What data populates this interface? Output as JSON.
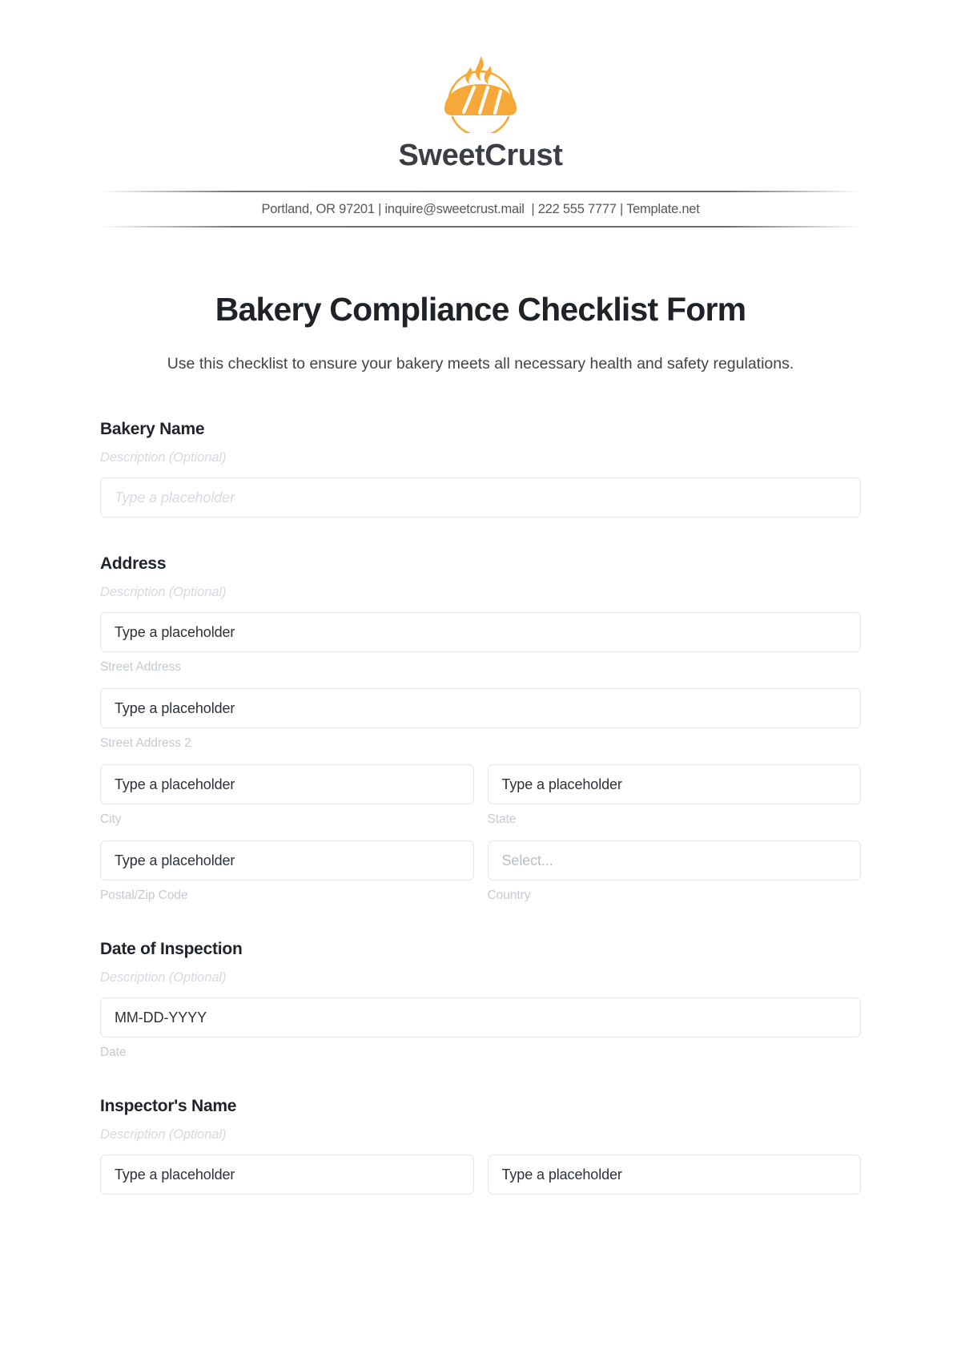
{
  "brand": {
    "name": "SweetCrust",
    "logo_icon": "bread-loaf-flame-icon",
    "contact": "Portland, OR 97201 | inquire@sweetcrust.mail  | 222 555 7777 | Template.net",
    "accent_color": "#F6A939",
    "text_color": "#3B3F45"
  },
  "form": {
    "title": "Bakery Compliance Checklist Form",
    "subtitle": "Use this checklist to ensure your bakery meets all necessary health and safety regulations.",
    "description_placeholder": "Description (Optional)",
    "groups": [
      {
        "label": "Bakery Name",
        "description": "Description (Optional)",
        "rows": [
          {
            "fields": [
              {
                "value": "Type a placeholder",
                "sub_label": "",
                "style": "ghost",
                "name": "bakery-name-input"
              }
            ]
          }
        ]
      },
      {
        "label": "Address",
        "description": "Description (Optional)",
        "rows": [
          {
            "fields": [
              {
                "value": "Type a placeholder",
                "sub_label": "Street Address",
                "style": "filled",
                "name": "street-address-input"
              }
            ]
          },
          {
            "fields": [
              {
                "value": "Type a placeholder",
                "sub_label": "Street Address 2",
                "style": "filled",
                "name": "street-address-2-input"
              }
            ]
          },
          {
            "fields": [
              {
                "value": "Type a placeholder",
                "sub_label": "City",
                "style": "filled",
                "name": "city-input"
              },
              {
                "value": "Type a placeholder",
                "sub_label": "State",
                "style": "filled",
                "name": "state-input"
              }
            ]
          },
          {
            "fields": [
              {
                "value": "Type a placeholder",
                "sub_label": "Postal/Zip Code",
                "style": "filled",
                "name": "postal-zip-input"
              },
              {
                "value": "Select...",
                "sub_label": "Country",
                "style": "select",
                "name": "country-select"
              }
            ]
          }
        ]
      },
      {
        "label": "Date of Inspection",
        "description": "Description (Optional)",
        "rows": [
          {
            "fields": [
              {
                "value": "MM-DD-YYYY",
                "sub_label": "Date",
                "style": "filled",
                "name": "date-of-inspection-input"
              }
            ]
          }
        ]
      },
      {
        "label": "Inspector's Name",
        "description": "Description (Optional)",
        "rows": [
          {
            "fields": [
              {
                "value": "Type a placeholder",
                "sub_label": "",
                "style": "filled",
                "name": "inspector-first-name-input"
              },
              {
                "value": "Type a placeholder",
                "sub_label": "",
                "style": "filled",
                "name": "inspector-last-name-input"
              }
            ]
          }
        ]
      }
    ]
  }
}
